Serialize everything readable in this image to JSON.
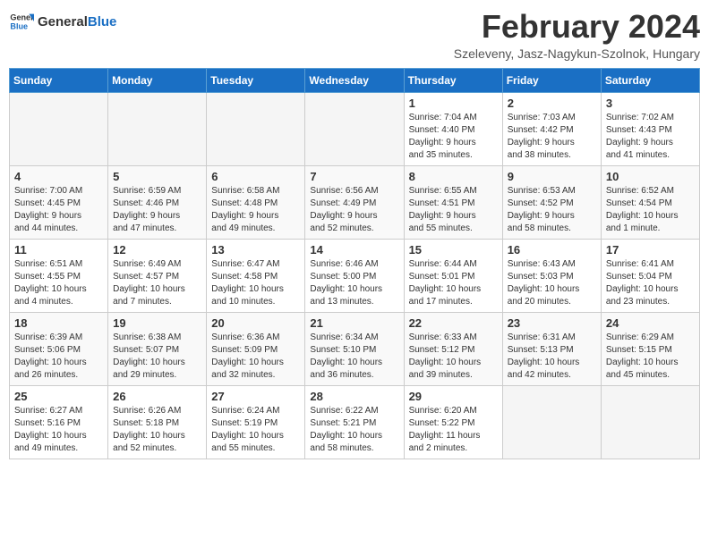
{
  "header": {
    "logo_general": "General",
    "logo_blue": "Blue",
    "title": "February 2024",
    "subtitle": "Szeleveny, Jasz-Nagykun-Szolnok, Hungary"
  },
  "days_of_week": [
    "Sunday",
    "Monday",
    "Tuesday",
    "Wednesday",
    "Thursday",
    "Friday",
    "Saturday"
  ],
  "weeks": [
    [
      {
        "day": "",
        "info": ""
      },
      {
        "day": "",
        "info": ""
      },
      {
        "day": "",
        "info": ""
      },
      {
        "day": "",
        "info": ""
      },
      {
        "day": "1",
        "info": "Sunrise: 7:04 AM\nSunset: 4:40 PM\nDaylight: 9 hours\nand 35 minutes."
      },
      {
        "day": "2",
        "info": "Sunrise: 7:03 AM\nSunset: 4:42 PM\nDaylight: 9 hours\nand 38 minutes."
      },
      {
        "day": "3",
        "info": "Sunrise: 7:02 AM\nSunset: 4:43 PM\nDaylight: 9 hours\nand 41 minutes."
      }
    ],
    [
      {
        "day": "4",
        "info": "Sunrise: 7:00 AM\nSunset: 4:45 PM\nDaylight: 9 hours\nand 44 minutes."
      },
      {
        "day": "5",
        "info": "Sunrise: 6:59 AM\nSunset: 4:46 PM\nDaylight: 9 hours\nand 47 minutes."
      },
      {
        "day": "6",
        "info": "Sunrise: 6:58 AM\nSunset: 4:48 PM\nDaylight: 9 hours\nand 49 minutes."
      },
      {
        "day": "7",
        "info": "Sunrise: 6:56 AM\nSunset: 4:49 PM\nDaylight: 9 hours\nand 52 minutes."
      },
      {
        "day": "8",
        "info": "Sunrise: 6:55 AM\nSunset: 4:51 PM\nDaylight: 9 hours\nand 55 minutes."
      },
      {
        "day": "9",
        "info": "Sunrise: 6:53 AM\nSunset: 4:52 PM\nDaylight: 9 hours\nand 58 minutes."
      },
      {
        "day": "10",
        "info": "Sunrise: 6:52 AM\nSunset: 4:54 PM\nDaylight: 10 hours\nand 1 minute."
      }
    ],
    [
      {
        "day": "11",
        "info": "Sunrise: 6:51 AM\nSunset: 4:55 PM\nDaylight: 10 hours\nand 4 minutes."
      },
      {
        "day": "12",
        "info": "Sunrise: 6:49 AM\nSunset: 4:57 PM\nDaylight: 10 hours\nand 7 minutes."
      },
      {
        "day": "13",
        "info": "Sunrise: 6:47 AM\nSunset: 4:58 PM\nDaylight: 10 hours\nand 10 minutes."
      },
      {
        "day": "14",
        "info": "Sunrise: 6:46 AM\nSunset: 5:00 PM\nDaylight: 10 hours\nand 13 minutes."
      },
      {
        "day": "15",
        "info": "Sunrise: 6:44 AM\nSunset: 5:01 PM\nDaylight: 10 hours\nand 17 minutes."
      },
      {
        "day": "16",
        "info": "Sunrise: 6:43 AM\nSunset: 5:03 PM\nDaylight: 10 hours\nand 20 minutes."
      },
      {
        "day": "17",
        "info": "Sunrise: 6:41 AM\nSunset: 5:04 PM\nDaylight: 10 hours\nand 23 minutes."
      }
    ],
    [
      {
        "day": "18",
        "info": "Sunrise: 6:39 AM\nSunset: 5:06 PM\nDaylight: 10 hours\nand 26 minutes."
      },
      {
        "day": "19",
        "info": "Sunrise: 6:38 AM\nSunset: 5:07 PM\nDaylight: 10 hours\nand 29 minutes."
      },
      {
        "day": "20",
        "info": "Sunrise: 6:36 AM\nSunset: 5:09 PM\nDaylight: 10 hours\nand 32 minutes."
      },
      {
        "day": "21",
        "info": "Sunrise: 6:34 AM\nSunset: 5:10 PM\nDaylight: 10 hours\nand 36 minutes."
      },
      {
        "day": "22",
        "info": "Sunrise: 6:33 AM\nSunset: 5:12 PM\nDaylight: 10 hours\nand 39 minutes."
      },
      {
        "day": "23",
        "info": "Sunrise: 6:31 AM\nSunset: 5:13 PM\nDaylight: 10 hours\nand 42 minutes."
      },
      {
        "day": "24",
        "info": "Sunrise: 6:29 AM\nSunset: 5:15 PM\nDaylight: 10 hours\nand 45 minutes."
      }
    ],
    [
      {
        "day": "25",
        "info": "Sunrise: 6:27 AM\nSunset: 5:16 PM\nDaylight: 10 hours\nand 49 minutes."
      },
      {
        "day": "26",
        "info": "Sunrise: 6:26 AM\nSunset: 5:18 PM\nDaylight: 10 hours\nand 52 minutes."
      },
      {
        "day": "27",
        "info": "Sunrise: 6:24 AM\nSunset: 5:19 PM\nDaylight: 10 hours\nand 55 minutes."
      },
      {
        "day": "28",
        "info": "Sunrise: 6:22 AM\nSunset: 5:21 PM\nDaylight: 10 hours\nand 58 minutes."
      },
      {
        "day": "29",
        "info": "Sunrise: 6:20 AM\nSunset: 5:22 PM\nDaylight: 11 hours\nand 2 minutes."
      },
      {
        "day": "",
        "info": ""
      },
      {
        "day": "",
        "info": ""
      }
    ]
  ]
}
